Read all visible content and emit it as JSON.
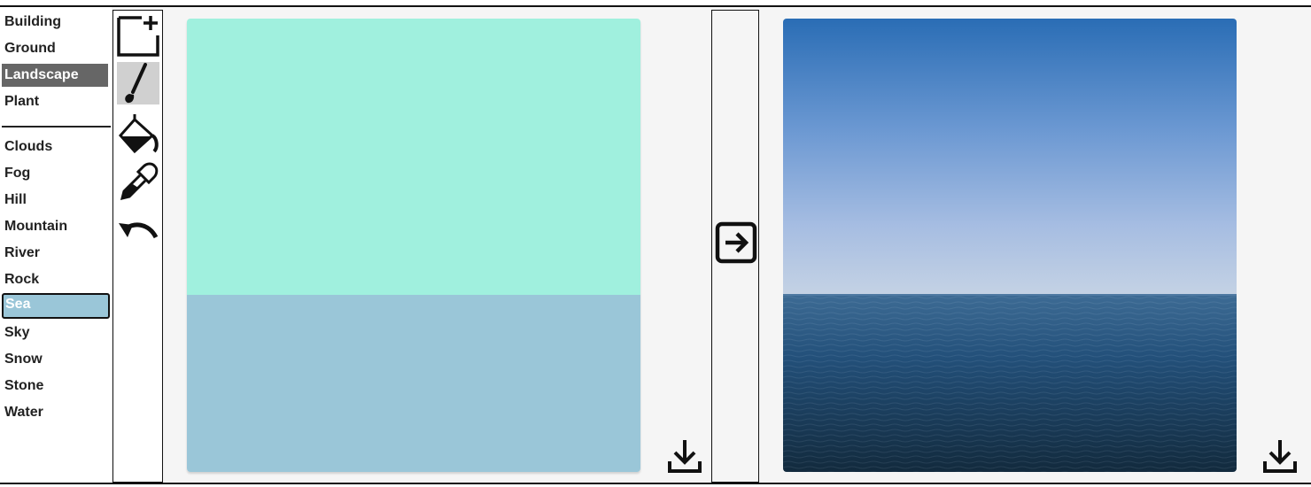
{
  "labels": {
    "groups": [
      [
        "Building",
        "Ground",
        "Landscape",
        "Plant"
      ],
      [
        "Clouds",
        "Fog",
        "Hill",
        "Mountain",
        "River",
        "Rock",
        "Sea",
        "Sky",
        "Snow",
        "Stone",
        "Water"
      ]
    ],
    "selected_category": "Landscape",
    "selected_label": "Sea"
  },
  "tools": [
    {
      "name": "new-canvas",
      "icon": "new-canvas-icon"
    },
    {
      "name": "brush",
      "icon": "brush-icon",
      "selected": true
    },
    {
      "name": "fill",
      "icon": "paint-bucket-icon"
    },
    {
      "name": "eyedropper",
      "icon": "eyedropper-icon"
    },
    {
      "name": "undo",
      "icon": "undo-icon"
    }
  ],
  "segmentation": {
    "regions": [
      {
        "label": "Sky",
        "color": "#a0f0de"
      },
      {
        "label": "Sea",
        "color": "#9ac6d8"
      }
    ]
  },
  "colors": {
    "selected_dark": "#666666",
    "sea_swatch": "#9ac6d8",
    "sky_swatch": "#a0f0de"
  },
  "actions": {
    "convert_icon": "arrow-right-box-icon",
    "download_icon": "download-icon"
  }
}
